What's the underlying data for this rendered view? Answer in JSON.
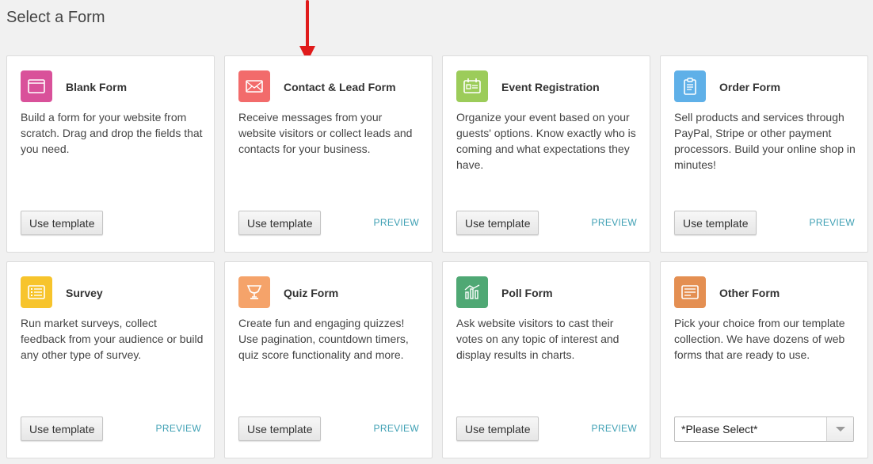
{
  "page": {
    "title": "Select a Form"
  },
  "colors": {
    "blank": "#d9519a",
    "contact": "#f26b6b",
    "event": "#9ccc5a",
    "order": "#5fb0e8",
    "survey": "#f7c42c",
    "quiz": "#f5a36a",
    "poll": "#4fa874",
    "other": "#e48f52",
    "preview": "#3fa0b4",
    "arrow": "#e01b1b"
  },
  "cards": [
    {
      "id": "blank",
      "icon": "browser-window-icon",
      "title": "Blank Form",
      "description": "Build a form for your website from scratch. Drag and drop the fields that you need.",
      "button": "Use template"
    },
    {
      "id": "contact",
      "icon": "envelope-icon",
      "title": "Contact & Lead Form",
      "description": "Receive messages from your website visitors or collect leads and contacts for your business.",
      "button": "Use template",
      "preview": "PREVIEW"
    },
    {
      "id": "event",
      "icon": "ticket-icon",
      "title": "Event Registration",
      "description": "Organize your event based on your guests' options. Know exactly who is coming and what expectations they have.",
      "button": "Use template",
      "preview": "PREVIEW"
    },
    {
      "id": "order",
      "icon": "clipboard-icon",
      "title": "Order Form",
      "description": "Sell products and services through PayPal, Stripe or other payment processors. Build your online shop in minutes!",
      "button": "Use template",
      "preview": "PREVIEW"
    },
    {
      "id": "survey",
      "icon": "list-icon",
      "title": "Survey",
      "description": "Run market surveys, collect feedback from your audience or build any other type of survey.",
      "button": "Use template",
      "preview": "PREVIEW"
    },
    {
      "id": "quiz",
      "icon": "trophy-icon",
      "title": "Quiz Form",
      "description": "Create fun and engaging quizzes! Use pagination, countdown timers, quiz score functionality and more.",
      "button": "Use template",
      "preview": "PREVIEW"
    },
    {
      "id": "poll",
      "icon": "bar-chart-icon",
      "title": "Poll Form",
      "description": "Ask website visitors to cast their votes on any topic of interest and display results in charts.",
      "button": "Use template",
      "preview": "PREVIEW"
    },
    {
      "id": "other",
      "icon": "document-icon",
      "title": "Other Form",
      "description": "Pick your choice from our template collection. We have dozens of web forms that are ready to use.",
      "select": "*Please Select*"
    }
  ]
}
